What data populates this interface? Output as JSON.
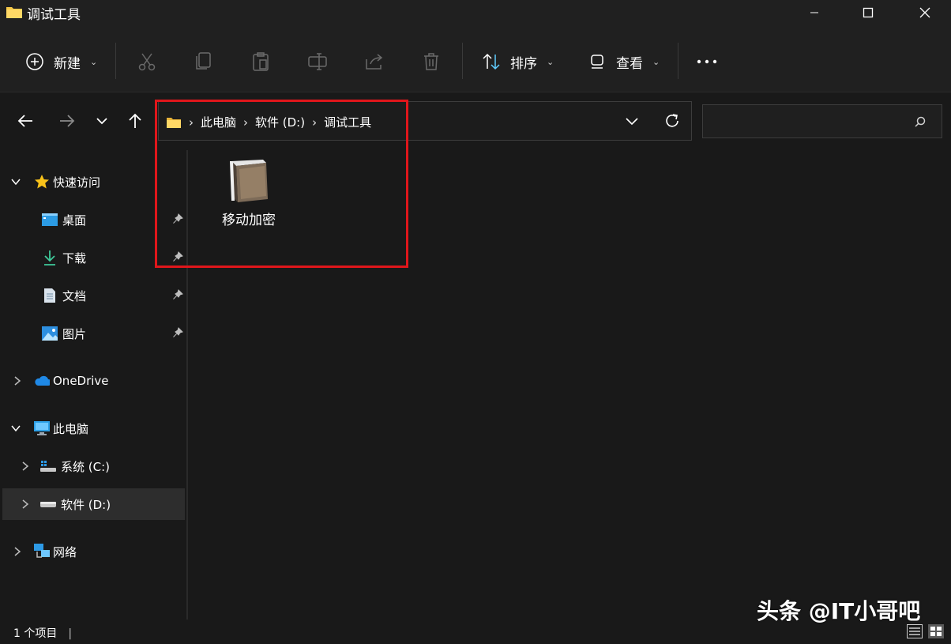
{
  "window": {
    "title": "调试工具"
  },
  "toolbar": {
    "new_label": "新建",
    "sort_label": "排序",
    "view_label": "查看"
  },
  "address": {
    "crumbs": [
      "此电脑",
      "软件 (D:)",
      "调试工具"
    ]
  },
  "search": {
    "placeholder": ""
  },
  "sidebar": {
    "quick_access": "快速访问",
    "items": [
      {
        "label": "桌面",
        "pinned": true
      },
      {
        "label": "下载",
        "pinned": true
      },
      {
        "label": "文档",
        "pinned": true
      },
      {
        "label": "图片",
        "pinned": true
      }
    ],
    "onedrive": "OneDrive",
    "this_pc": "此电脑",
    "drives": [
      {
        "label": "系统 (C:)"
      },
      {
        "label": "软件 (D:)",
        "selected": true
      }
    ],
    "network": "网络"
  },
  "content": {
    "items": [
      {
        "name": "移动加密",
        "icon": "archive-icon"
      }
    ]
  },
  "status": {
    "count_text": "1 个项目"
  },
  "watermark": {
    "text": "头条 @IT小哥吧"
  },
  "colors": {
    "highlight": "#e0161b",
    "accent_folder": "#f7c948",
    "background": "#191919"
  }
}
